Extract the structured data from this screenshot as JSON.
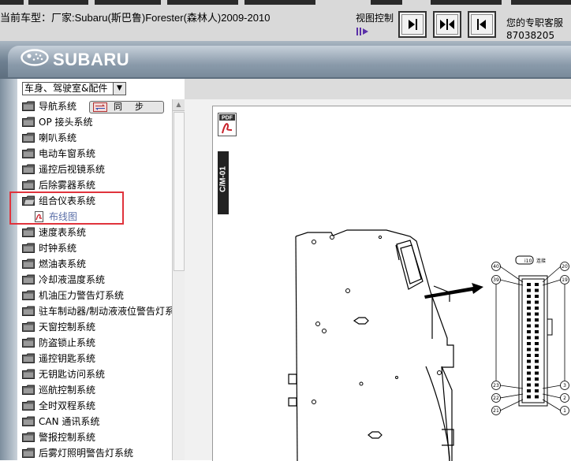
{
  "header": {
    "model_label": "当前车型：厂家:Subaru(斯巴鲁)Forester(森林人)2009-2010",
    "view_control_label": "视图控制",
    "service_label": "您的专职客服",
    "service_number": "87038205"
  },
  "brand": {
    "name": "SUBARU"
  },
  "sidebar": {
    "category_select_value": "车身、驾驶室&配件",
    "sync_button_label": "同步",
    "items": [
      {
        "label": "导航系统"
      },
      {
        "label": "OP 接头系统"
      },
      {
        "label": "喇叭系统"
      },
      {
        "label": "电动车窗系统"
      },
      {
        "label": "遥控后视镜系统"
      },
      {
        "label": "后除雾器系统"
      },
      {
        "label": "组合仪表系统",
        "expanded": true,
        "child": "布线图"
      },
      {
        "label": "速度表系统"
      },
      {
        "label": "时钟系统"
      },
      {
        "label": "燃油表系统"
      },
      {
        "label": "冷却液温度系统"
      },
      {
        "label": "机油压力警告灯系统"
      },
      {
        "label": "驻车制动器/制动液液位警告灯系统"
      },
      {
        "label": "天窗控制系统"
      },
      {
        "label": "防盗锁止系统"
      },
      {
        "label": "遥控钥匙系统"
      },
      {
        "label": "无钥匙访问系统"
      },
      {
        "label": "巡航控制系统"
      },
      {
        "label": "全时双程系统"
      },
      {
        "label": "CAN 通讯系统"
      },
      {
        "label": "警报控制系统"
      },
      {
        "label": "后雾灯照明警告灯系统"
      }
    ]
  },
  "document": {
    "pdf_icon_text": "PDF",
    "page_tag": "C/M-01",
    "connector_label": "i10",
    "connector_note": "连接",
    "pin_labels_left": [
      "40",
      "39",
      "23",
      "22",
      "21"
    ],
    "pin_labels_right": [
      "20",
      "19",
      "3",
      "2",
      "1"
    ]
  },
  "colors": {
    "highlight": "#e0333c",
    "link": "#5b6fa8"
  }
}
